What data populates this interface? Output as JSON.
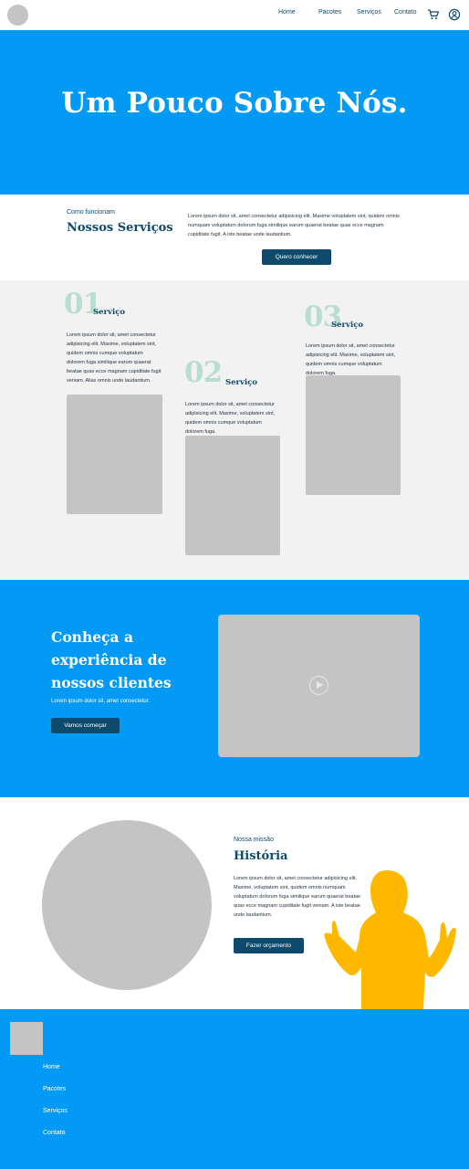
{
  "nav": {
    "links": [
      "Home",
      "Pacotes",
      "Serviços",
      "Contato"
    ],
    "cart_icon": "cart-icon",
    "user_icon": "user-icon"
  },
  "hero": {
    "title": "Um Pouco Sobre Nós."
  },
  "intro": {
    "eyebrow": "Como funcionam",
    "heading": "Nossos Serviços",
    "text": "Lorem ipsum dolor sit, amet consectetur adipisicing elit. Maxime voluptatem sint, quidem omnis numquam voluptatum dolorum fuga similique earum quaerat beatae quas ecce magnam cupiditate fugit. A iste beatae unde laudantium.",
    "button": "Quero conhecer"
  },
  "services": [
    {
      "number": "01",
      "title": "Serviço",
      "text": "Lorem ipsum dolor sit, amet consectetur adipisicing elit. Maxime, voluptatem sint, quidem omnis cumque voluptatum dolorem fuga similique earum quaerat beatae quas ecce magnam cupiditate fugit veniam. Alias omnis unde laudantium."
    },
    {
      "number": "02",
      "title": "Serviço",
      "text": "Lorem ipsum dolor sit, amet consectetur adipisicing elit. Maxime, voluptatem sint, quidem omnis cumque voluptatum dolorem fuga."
    },
    {
      "number": "03",
      "title": "Serviço",
      "text": "Lorem ipsum dolor sit, amet consectetur adipisicing elit. Maxime, voluptatem sint, quidem omnis cumque voluptatum dolorem fuga."
    }
  ],
  "experience": {
    "heading": "Conheça a experiência de nossos clientes",
    "subtext": "Lorem ipsum dolor sit, amet consectetur.",
    "button": "Vamos começar",
    "play_icon": "play-icon"
  },
  "history": {
    "eyebrow": "Nossa missão",
    "heading": "História",
    "text": "Lorem ipsum dolor sit, amet consectetur adipisicing elit. Maxime, voluptatem sint, quidem omnis numquam voluptatum dolorum fuga similique earum quaerat beatae quas ecce magnam cupiditate fugit veniam. A iste beatae unde laudantium.",
    "button": "Fazer orçamento",
    "accent_color": "#ffb800"
  },
  "footer": {
    "links": [
      "Home",
      "Pacotes",
      "Serviços",
      "Contato"
    ]
  },
  "colors": {
    "primary_blue": "#039af5",
    "dark_teal": "#0d4a6b",
    "placeholder_gray": "#c4c4c4",
    "section_gray": "#f2f2f2",
    "number_mint": "#b9ddd0"
  }
}
